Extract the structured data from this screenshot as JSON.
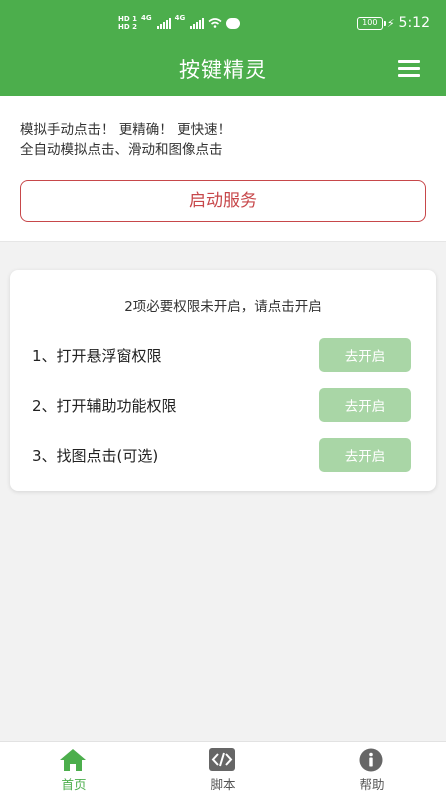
{
  "status_bar": {
    "hd1": "HD 1",
    "hd2": "HD 2",
    "sig1_label": "4G",
    "sig2_label": "4G",
    "battery": "100",
    "time": "5:12"
  },
  "app": {
    "title": "按键精灵"
  },
  "intro": {
    "line1": "模拟手动点击！ 更精确！ 更快速！",
    "line2": "全自动模拟点击、滑动和图像点击",
    "start_button": "启动服务"
  },
  "permissions": {
    "title": "2项必要权限未开启，请点击开启",
    "items": [
      {
        "label": "1、打开悬浮窗权限",
        "button": "去开启"
      },
      {
        "label": "2、打开辅助功能权限",
        "button": "去开启"
      },
      {
        "label": "3、找图点击(可选)",
        "button": "去开启"
      }
    ]
  },
  "nav": {
    "items": [
      {
        "label": "首页",
        "icon": "home-icon",
        "active": true
      },
      {
        "label": "脚本",
        "icon": "code-icon",
        "active": false
      },
      {
        "label": "帮助",
        "icon": "info-icon",
        "active": false
      }
    ]
  },
  "colors": {
    "brand_green": "#4cae4c",
    "accent_red": "#c7474a",
    "button_green_light": "#a9d6a6"
  }
}
